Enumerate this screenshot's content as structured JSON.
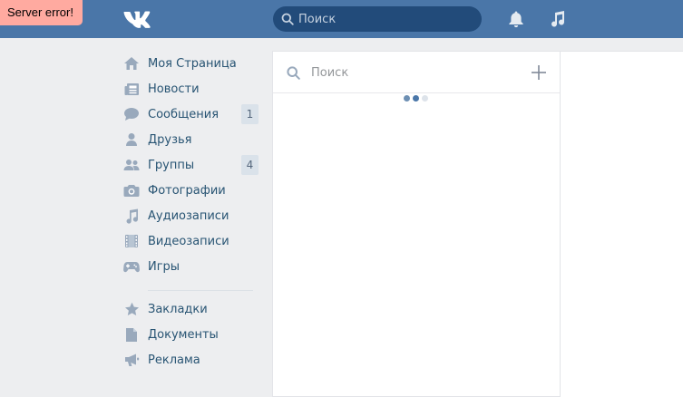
{
  "header": {
    "search_placeholder": "Поиск",
    "icons": [
      "vk-logo-icon",
      "search-icon",
      "bell-icon",
      "music-icon"
    ]
  },
  "error_banner": {
    "text": "Server error!"
  },
  "sidebar": {
    "items": [
      {
        "label": "Моя Страница",
        "icon": "home-icon"
      },
      {
        "label": "Новости",
        "icon": "news-icon"
      },
      {
        "label": "Сообщения",
        "icon": "messages-icon",
        "count": "1"
      },
      {
        "label": "Друзья",
        "icon": "friends-icon"
      },
      {
        "label": "Группы",
        "icon": "groups-icon",
        "count": "4"
      },
      {
        "label": "Фотографии",
        "icon": "camera-icon"
      },
      {
        "label": "Аудиозаписи",
        "icon": "music-note-icon"
      },
      {
        "label": "Видеозаписи",
        "icon": "film-icon"
      },
      {
        "label": "Игры",
        "icon": "gamepad-icon"
      }
    ],
    "secondary": [
      {
        "label": "Закладки",
        "icon": "star-icon"
      },
      {
        "label": "Документы",
        "icon": "document-icon"
      },
      {
        "label": "Реклама",
        "icon": "megaphone-icon"
      }
    ]
  },
  "messages_panel": {
    "search_placeholder": "Поиск",
    "loading": true
  },
  "colors": {
    "header_bg": "#4a76a8",
    "page_bg": "#edeef0",
    "link": "#285473",
    "icon": "#99a9bc",
    "error_bg": "#ffaaa0"
  }
}
